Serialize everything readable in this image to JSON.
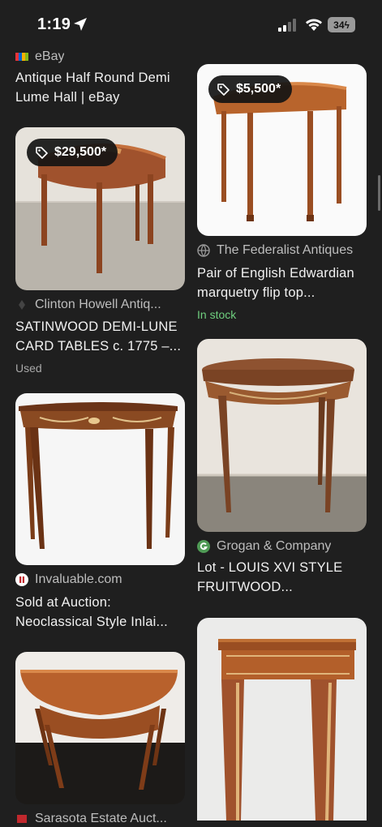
{
  "status_bar": {
    "time": "1:19",
    "battery": "34"
  },
  "results": {
    "ebay": {
      "source": "eBay",
      "title_line1": "Antique Half Round Demi",
      "title_line2": "Lume Hall | eBay"
    },
    "clinton": {
      "price": "$29,500*",
      "source": "Clinton Howell Antiq...",
      "title_line1": "SATINWOOD DEMI-LUNE",
      "title_line2": "CARD TABLES c. 1775 –...",
      "meta": "Used"
    },
    "invaluable": {
      "source": "Invaluable.com",
      "title_line1": "Sold at Auction:",
      "title_line2": "Neoclassical Style Inlai..."
    },
    "sarasota": {
      "source": "Sarasota Estate Auct..."
    },
    "federalist": {
      "price": "$5,500*",
      "source": "The Federalist Antiques",
      "title_line1": "Pair of English Edwardian",
      "title_line2": "marquetry flip top...",
      "meta": "In stock"
    },
    "grogan": {
      "source": "Grogan & Company",
      "title_line1": "Lot - LOUIS XVI STYLE",
      "title_line2": "FRUITWOOD..."
    },
    "last": {}
  },
  "colors": {
    "background": "#1f1f1f",
    "in_stock": "#6fcf7e"
  }
}
